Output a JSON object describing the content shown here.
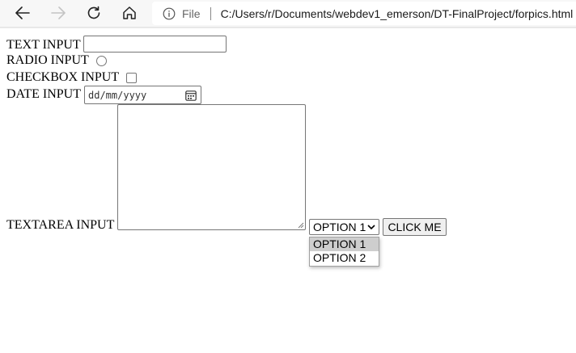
{
  "browser": {
    "protocol_label": "File",
    "url": "C:/Users/r/Documents/webdev1_emerson/DT-FinalProject/forpics.html",
    "icons": [
      "back-arrow-icon",
      "forward-arrow-icon",
      "reload-icon",
      "home-icon",
      "info-icon"
    ]
  },
  "form": {
    "text_label": "TEXT INPUT",
    "text_value": "",
    "radio_label": "RADIO INPUT",
    "radio_checked": false,
    "checkbox_label": "CHECKBOX INPUT",
    "checkbox_checked": false,
    "date_label": "DATE INPUT",
    "date_placeholder": "dd/mm/yyyy",
    "textarea_label": "TEXTAREA INPUT",
    "textarea_value": "",
    "select_value": "OPTION 1",
    "select_options": [
      "OPTION 1",
      "OPTION 2"
    ],
    "button_label": "CLICK ME"
  },
  "colors": {
    "chrome_background": "#f7f7f7",
    "control_border": "#767676",
    "option_highlight": "#cecece"
  }
}
